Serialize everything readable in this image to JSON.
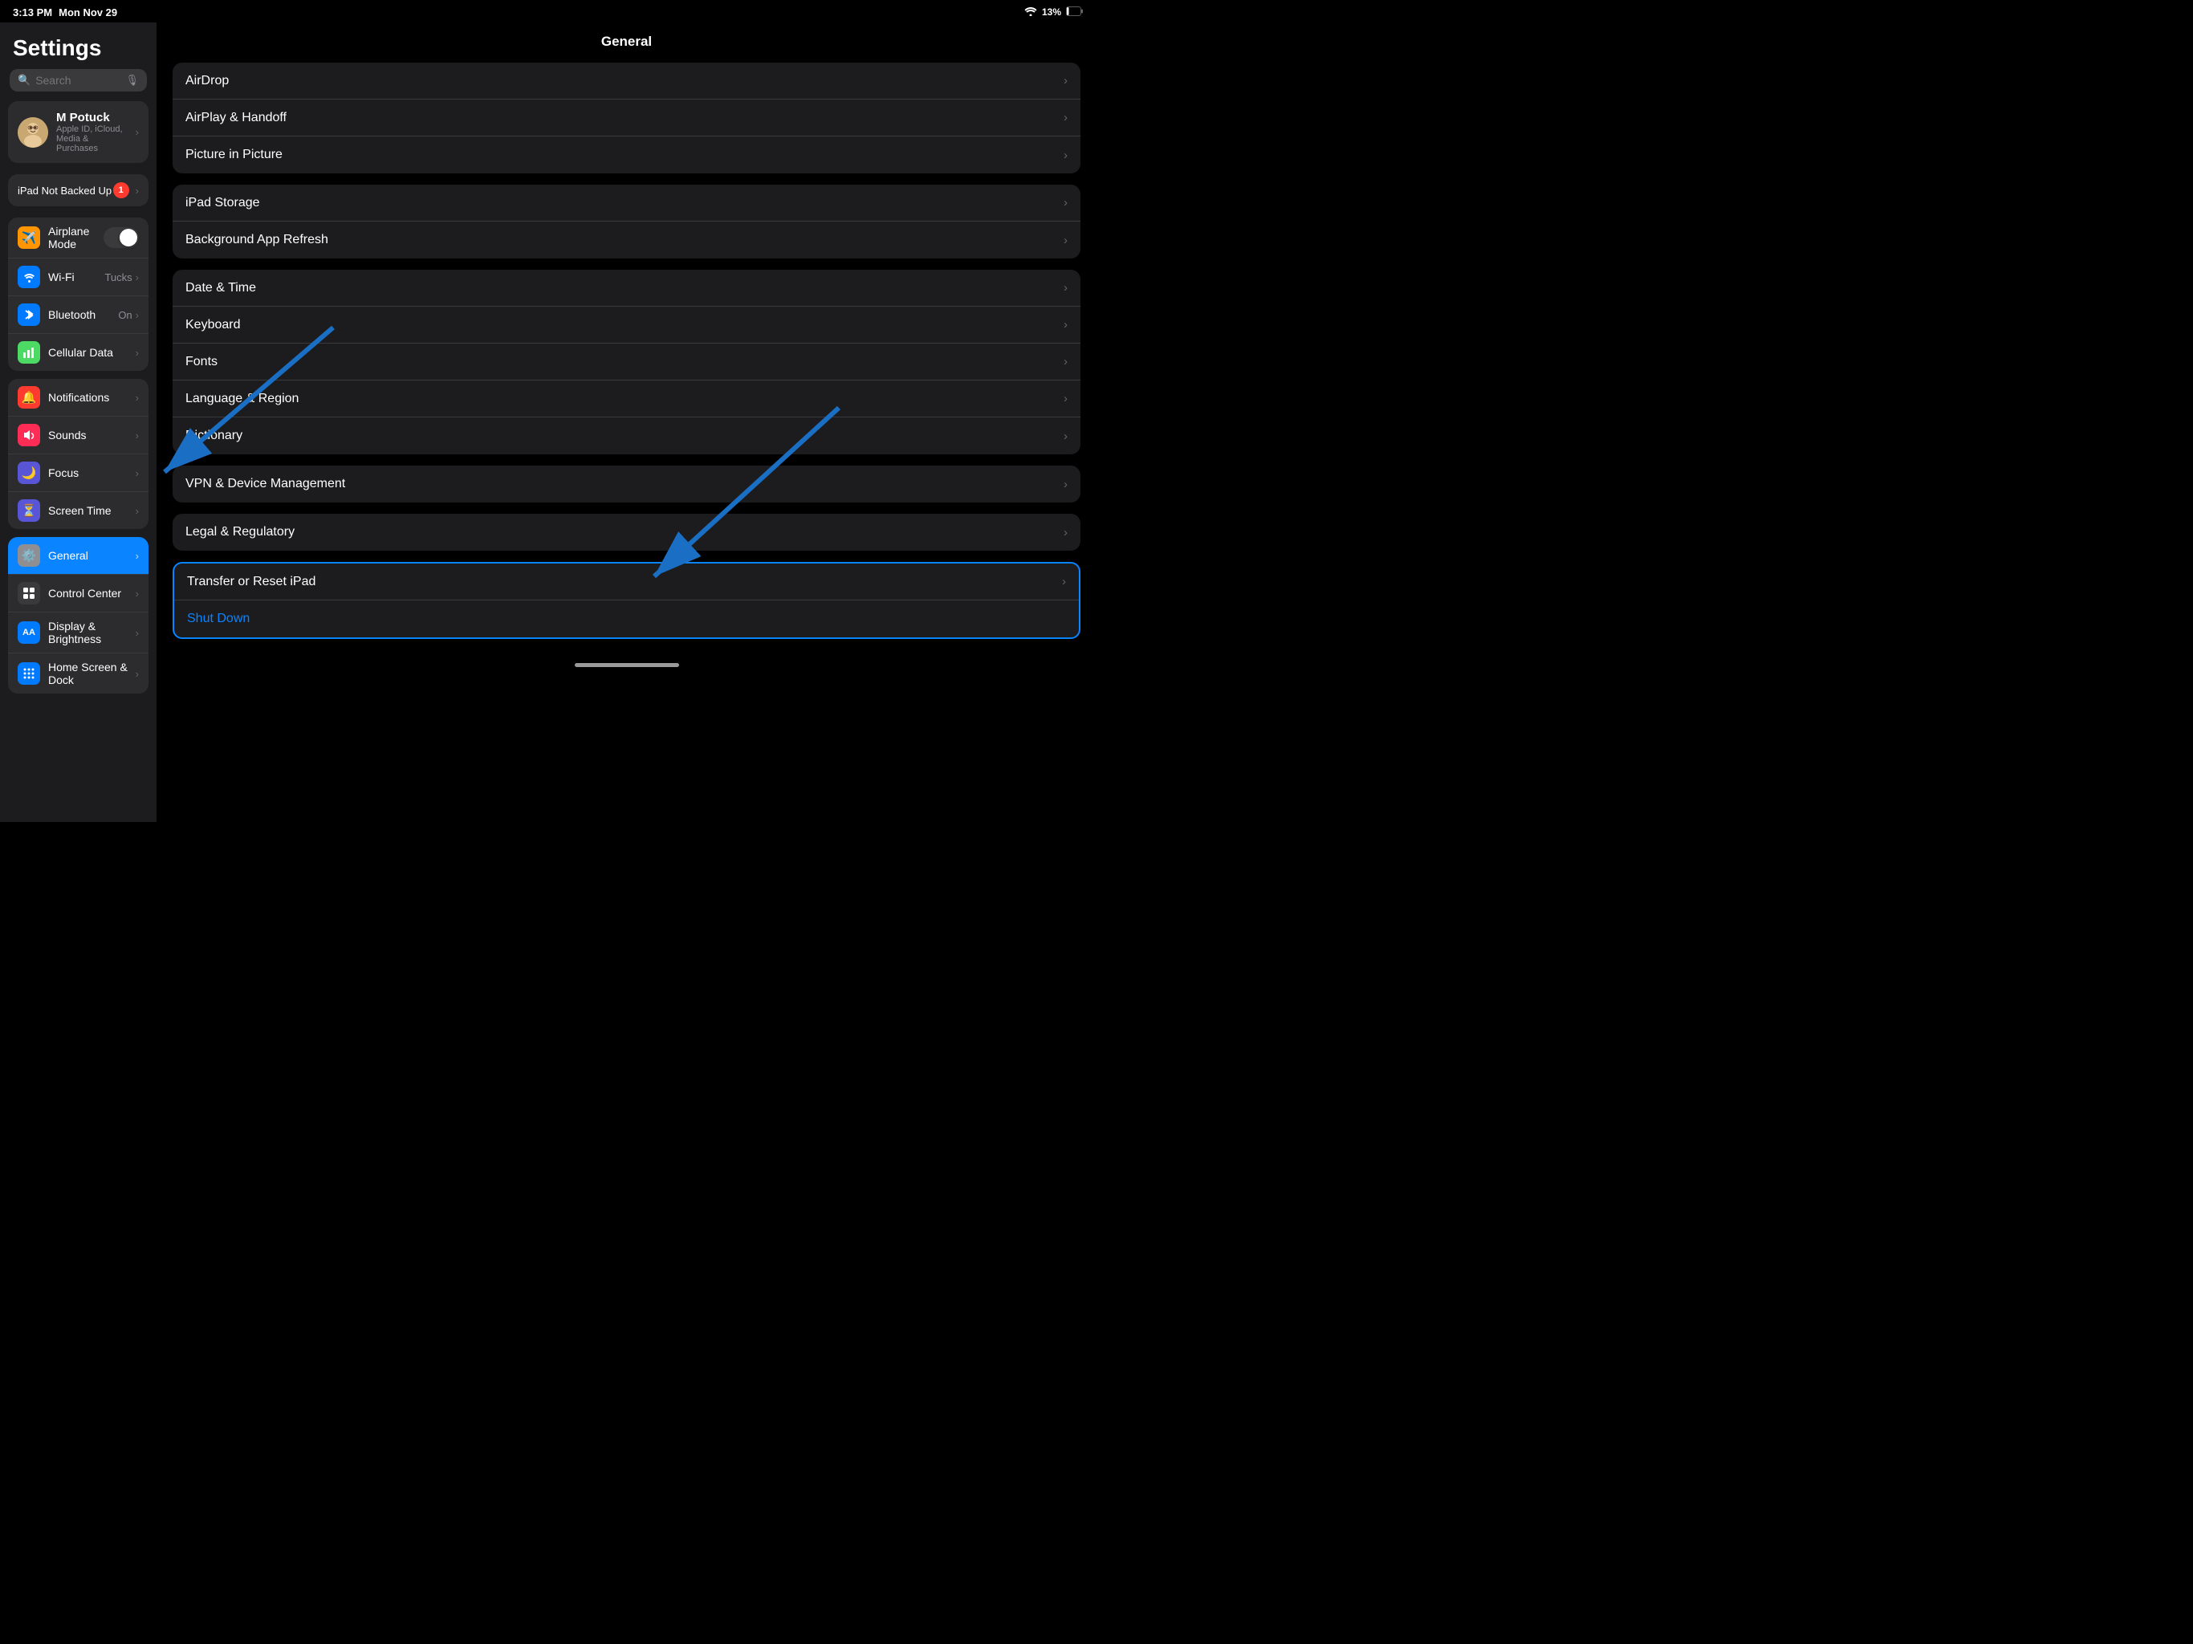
{
  "statusBar": {
    "time": "3:13 PM",
    "day": "Mon Nov 29",
    "wifi": "wifi-icon",
    "battery": "13%"
  },
  "sidebar": {
    "title": "Settings",
    "search": {
      "placeholder": "Search"
    },
    "user": {
      "name": "M Potuck",
      "subtitle": "Apple ID, iCloud, Media & Purchases",
      "avatar": "🧑‍💼"
    },
    "backup": {
      "label": "iPad Not Backed Up",
      "badge": "1"
    },
    "groups": [
      {
        "items": [
          {
            "id": "airplane",
            "label": "Airplane Mode",
            "iconBg": "#ff9500",
            "icon": "✈️",
            "toggle": true
          },
          {
            "id": "wifi",
            "label": "Wi-Fi",
            "iconBg": "#007aff",
            "icon": "📶",
            "value": "Tucks"
          },
          {
            "id": "bluetooth",
            "label": "Bluetooth",
            "iconBg": "#007aff",
            "icon": "🔷",
            "value": "On"
          },
          {
            "id": "cellular",
            "label": "Cellular Data",
            "iconBg": "#4cd964",
            "icon": "📱"
          }
        ]
      },
      {
        "items": [
          {
            "id": "notifications",
            "label": "Notifications",
            "iconBg": "#ff3b30",
            "icon": "🔔"
          },
          {
            "id": "sounds",
            "label": "Sounds",
            "iconBg": "#ff2d55",
            "icon": "🔊"
          },
          {
            "id": "focus",
            "label": "Focus",
            "iconBg": "#5856d6",
            "icon": "🌙"
          },
          {
            "id": "screentime",
            "label": "Screen Time",
            "iconBg": "#5856d6",
            "icon": "⏳"
          }
        ]
      },
      {
        "items": [
          {
            "id": "general",
            "label": "General",
            "iconBg": "#8e8e93",
            "icon": "⚙️",
            "active": true
          },
          {
            "id": "controlcenter",
            "label": "Control Center",
            "iconBg": "#3a3a3c",
            "icon": "🎛"
          },
          {
            "id": "display",
            "label": "Display & Brightness",
            "iconBg": "#007aff",
            "icon": "🔡"
          },
          {
            "id": "homescreen",
            "label": "Home Screen & Dock",
            "iconBg": "#007aff",
            "icon": "⠿"
          }
        ]
      }
    ]
  },
  "content": {
    "title": "General",
    "groups": [
      {
        "items": [
          {
            "id": "airdrop",
            "label": "AirDrop"
          },
          {
            "id": "airplay",
            "label": "AirPlay & Handoff"
          },
          {
            "id": "pip",
            "label": "Picture in Picture"
          }
        ]
      },
      {
        "items": [
          {
            "id": "storage",
            "label": "iPad Storage"
          },
          {
            "id": "bgrefresh",
            "label": "Background App Refresh"
          }
        ]
      },
      {
        "items": [
          {
            "id": "datetime",
            "label": "Date & Time"
          },
          {
            "id": "keyboard",
            "label": "Keyboard"
          },
          {
            "id": "fonts",
            "label": "Fonts"
          },
          {
            "id": "language",
            "label": "Language & Region"
          },
          {
            "id": "dictionary",
            "label": "Dictionary"
          }
        ]
      },
      {
        "items": [
          {
            "id": "vpn",
            "label": "VPN & Device Management"
          }
        ]
      },
      {
        "items": [
          {
            "id": "legal",
            "label": "Legal & Regulatory"
          }
        ]
      },
      {
        "items": [
          {
            "id": "transfer",
            "label": "Transfer or Reset iPad",
            "highlighted": true
          },
          {
            "id": "shutdown",
            "label": "Shut Down",
            "isLink": true
          }
        ]
      }
    ]
  },
  "arrows": {
    "arrow1": "points to Sounds in sidebar",
    "arrow2": "points to Transfer or Reset iPad in content"
  }
}
